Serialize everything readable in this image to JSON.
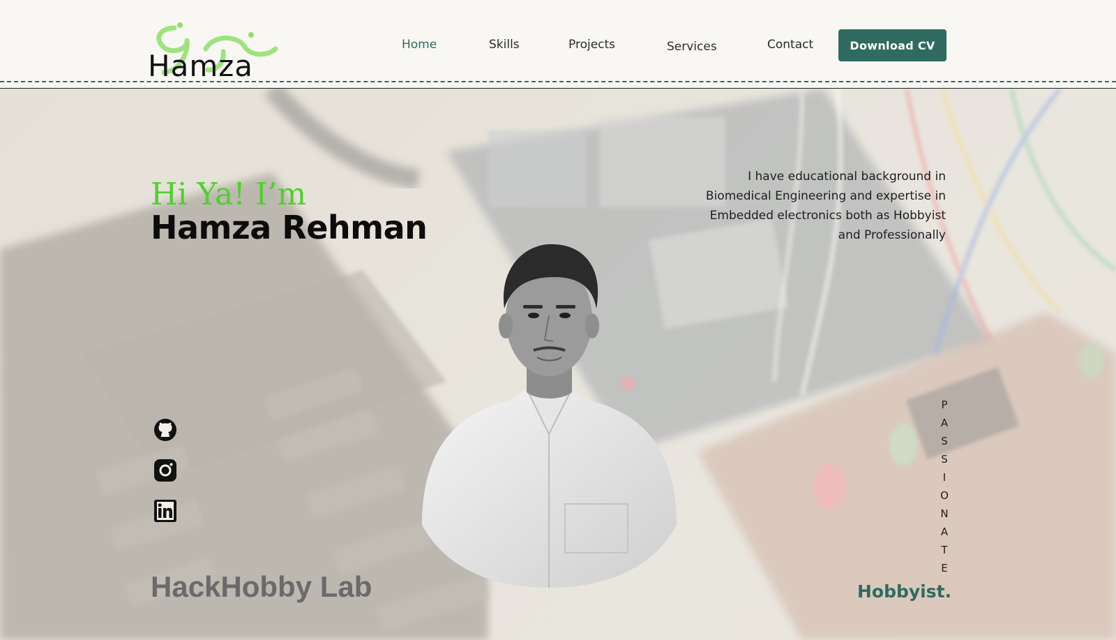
{
  "logo": {
    "text": "Hamza",
    "script_text": "حمزہ",
    "accent_color": "#8fe06a"
  },
  "nav": {
    "items": [
      {
        "label": "Home",
        "active": true
      },
      {
        "label": "Skills",
        "active": false
      },
      {
        "label": "Projects",
        "active": false
      },
      {
        "label": "Services",
        "active": false
      },
      {
        "label": "Contact",
        "active": false
      }
    ],
    "cta_label": "Download CV"
  },
  "hero": {
    "greeting": "Hi Ya! I’m",
    "name": "Hamza Rehman",
    "bio": "I have educational background in Biomedical Engineering and expertise in Embedded electronics both as Hobbyist and Professionally",
    "brand": "HackHobby Lab",
    "vertical_letters": [
      "P",
      "A",
      "S",
      "S",
      "I",
      "O",
      "N",
      "A",
      "T",
      "E"
    ],
    "role": "Hobbyist.",
    "social": [
      {
        "icon": "github-icon"
      },
      {
        "icon": "instagram-icon"
      },
      {
        "icon": "linkedin-icon"
      }
    ]
  },
  "colors": {
    "primary": "#2f6b60",
    "greeting_green": "#4fd02a",
    "background": "#f8f7f3"
  }
}
